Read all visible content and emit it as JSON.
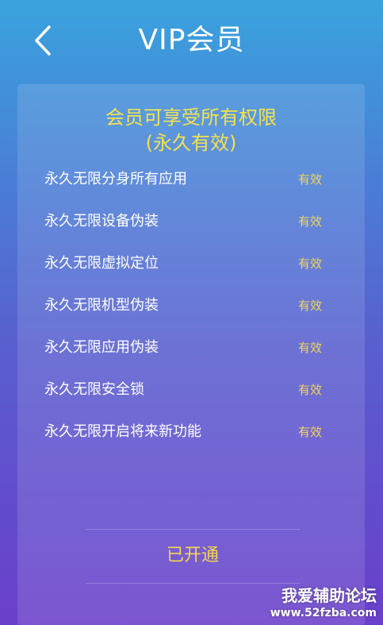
{
  "header": {
    "title": "VIP会员",
    "back_icon": "chevron-left-icon"
  },
  "card": {
    "title": "会员可享受所有权限",
    "subtitle": "(永久有效)",
    "benefits": [
      {
        "label": "永久无限分身所有应用",
        "status": "有效"
      },
      {
        "label": "永久无限设备伪装",
        "status": "有效"
      },
      {
        "label": "永久无限虚拟定位",
        "status": "有效"
      },
      {
        "label": "永久无限机型伪装",
        "status": "有效"
      },
      {
        "label": "永久无限应用伪装",
        "status": "有效"
      },
      {
        "label": "永久无限安全锁",
        "status": "有效"
      },
      {
        "label": "永久无限开启将来新功能",
        "status": "有效"
      }
    ],
    "action_label": "已开通"
  },
  "watermark": {
    "line1": "我爱辅助论坛",
    "line2": "www.52fzba.com"
  },
  "colors": {
    "accent_yellow": "#f4e14f",
    "gradient_top": "#3aa3dd",
    "gradient_bottom": "#6a3fca"
  }
}
